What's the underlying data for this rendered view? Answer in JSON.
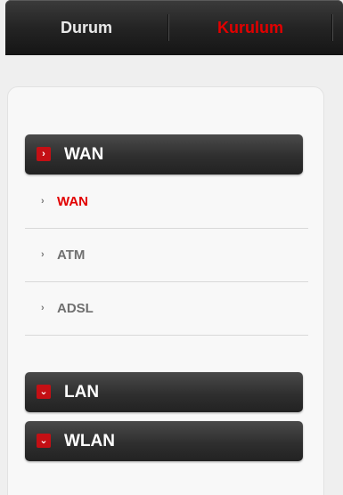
{
  "tabs": {
    "status": "Durum",
    "setup": "Kurulum"
  },
  "sidebar": {
    "wan": {
      "label": "WAN",
      "toggle": "›",
      "items": [
        {
          "label": "WAN",
          "active": true
        },
        {
          "label": "ATM",
          "active": false
        },
        {
          "label": "ADSL",
          "active": false
        }
      ]
    },
    "lan": {
      "label": "LAN",
      "toggle": "⌄"
    },
    "wlan": {
      "label": "WLAN",
      "toggle": "⌄"
    }
  },
  "icons": {
    "item_chevron": "›"
  },
  "colors": {
    "active_text": "#e20000",
    "toggle_red": "#c40f14",
    "header_dark": "#2f2f2f"
  }
}
